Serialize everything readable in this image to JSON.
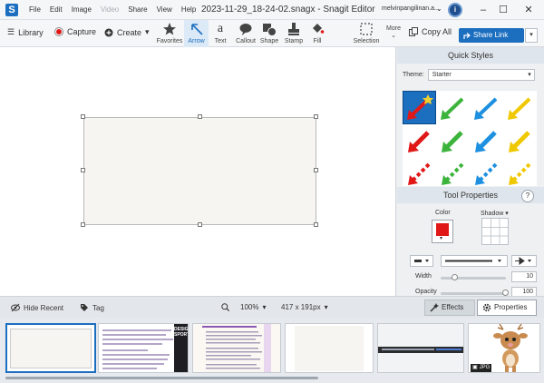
{
  "titlebar": {
    "menu": [
      "File",
      "Edit",
      "Image",
      "Video",
      "Share",
      "View",
      "Help"
    ],
    "disabled_menu": "Video",
    "title": "2023-11-29_18-24-02.snagx - Snagit Editor",
    "user": "melvinpangilinan.a...",
    "info_glyph": "i"
  },
  "toolbar": {
    "library": "Library",
    "capture": "Capture",
    "create": "Create",
    "tools": [
      "Favorites",
      "Arrow",
      "Text",
      "Callout",
      "Shape",
      "Stamp",
      "Fill"
    ],
    "active_tool": "Arrow",
    "selection": "Selection",
    "more": "More",
    "copy_all": "Copy All",
    "share_link": "Share Link"
  },
  "quick_styles": {
    "title": "Quick Styles",
    "theme_label": "Theme:",
    "theme_value": "Starter",
    "arrow_colors": [
      "#e01818",
      "#3cb43c",
      "#1e90e0",
      "#f0c800"
    ]
  },
  "tool_properties": {
    "title": "Tool Properties",
    "help": "?",
    "color_label": "Color",
    "shadow_label": "Shadow",
    "color_value": "#e01818",
    "width_label": "Width",
    "width_value": "10",
    "opacity_label": "Opacity",
    "opacity_value": "100"
  },
  "bottombar": {
    "hide_recent": "Hide Recent",
    "tag": "Tag",
    "zoom": "100%",
    "size": "417 x 191px",
    "effects": "Effects",
    "properties": "Properties"
  },
  "tray": {
    "thumb_jpg_badge": "JPG",
    "thumb_design_text": "DESIGN SPORT"
  },
  "colors": {
    "accent": "#1c6fbf",
    "canvas_fill": "#f6f5f1",
    "selected_arrow": "#e01818"
  }
}
